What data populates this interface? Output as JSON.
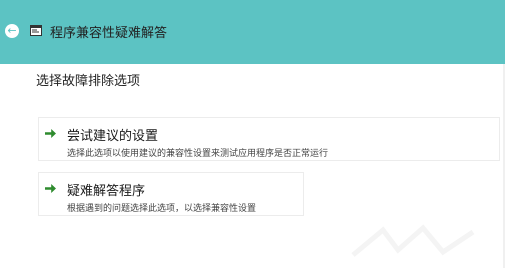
{
  "window": {
    "title": "程序兼容性疑难解答",
    "back_icon": "back-arrow-icon",
    "app_icon": "program-window-icon",
    "titlebar_color": "#5cc3c3"
  },
  "main": {
    "heading": "选择故障排除选项",
    "options": [
      {
        "title": "尝试建议的设置",
        "description": "选择此选项以使用建议的兼容性设置来测试应用程序是否正常运行",
        "icon": "green-arrow-icon"
      },
      {
        "title": "疑难解答程序",
        "description": "根据遇到的问题选择此选项，以选择兼容性设置",
        "icon": "green-arrow-icon"
      }
    ],
    "arrow_color": "#2e8b2e"
  }
}
